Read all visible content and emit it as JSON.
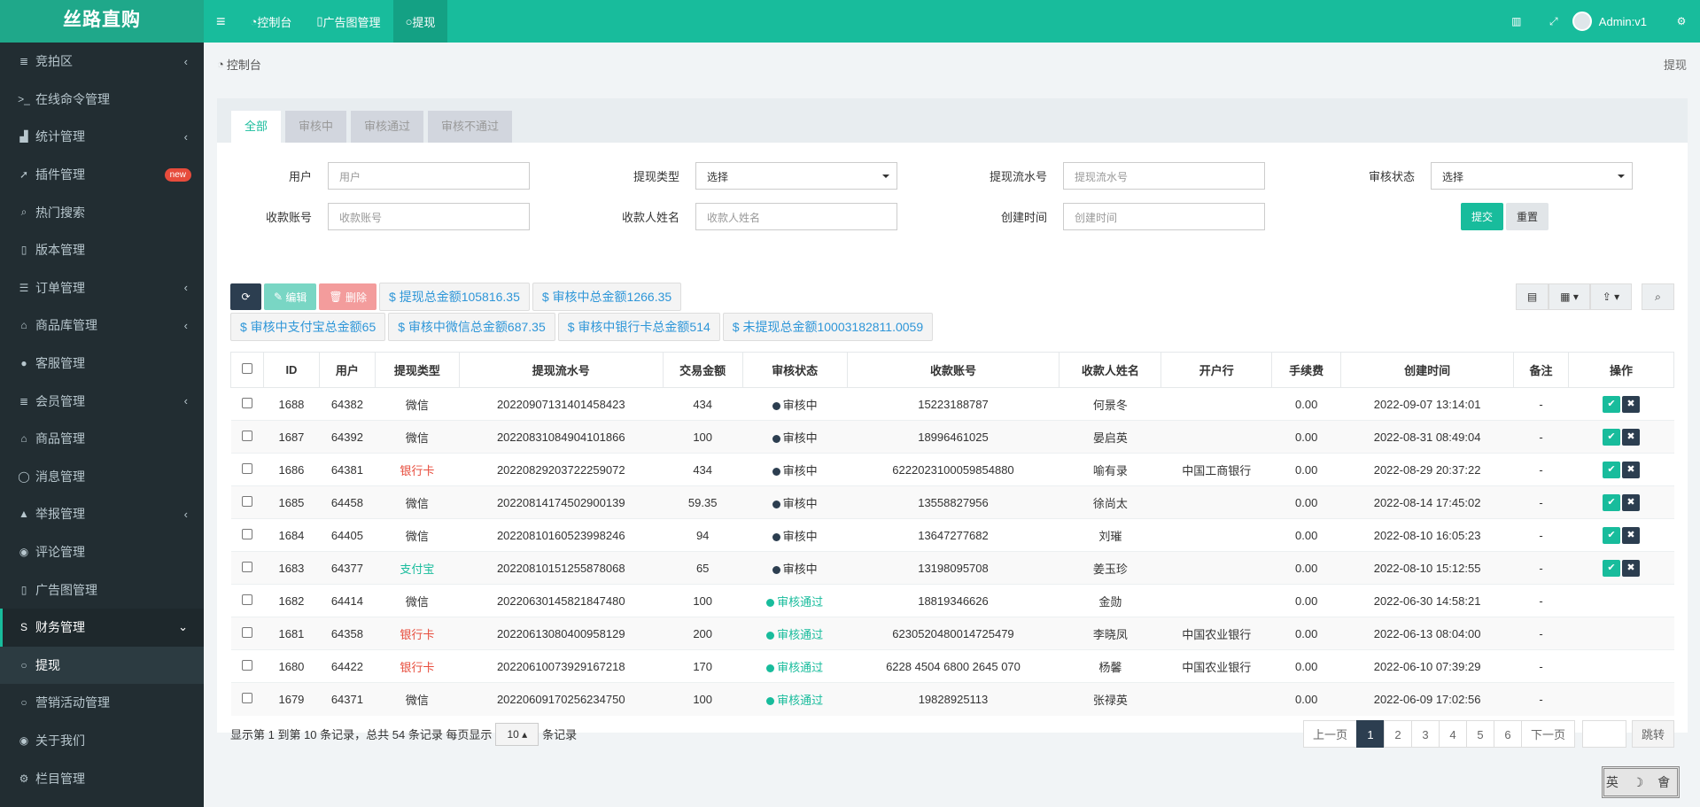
{
  "logo": "丝路直购",
  "sidebar": {
    "items": [
      {
        "label": "竞拍区",
        "icon": "list-icon",
        "arrow": "‹"
      },
      {
        "label": "在线命令管理",
        "icon": "terminal-icon",
        "arrow": ""
      },
      {
        "label": "统计管理",
        "icon": "bar-chart-icon",
        "arrow": "‹"
      },
      {
        "label": "插件管理",
        "icon": "rocket-icon",
        "arrow": "",
        "badge": "new"
      },
      {
        "label": "热门搜索",
        "icon": "search-icon",
        "arrow": ""
      },
      {
        "label": "版本管理",
        "icon": "file-icon",
        "arrow": ""
      },
      {
        "label": "订单管理",
        "icon": "list-alt-icon",
        "arrow": "‹"
      },
      {
        "label": "商品库管理",
        "icon": "bank-icon",
        "arrow": "‹"
      },
      {
        "label": "客服管理",
        "icon": "user-icon",
        "arrow": ""
      },
      {
        "label": "会员管理",
        "icon": "list-icon",
        "arrow": "‹"
      },
      {
        "label": "商品管理",
        "icon": "institution-icon",
        "arrow": ""
      },
      {
        "label": "消息管理",
        "icon": "comments-icon",
        "arrow": ""
      },
      {
        "label": "举报管理",
        "icon": "warning-icon",
        "arrow": "‹"
      },
      {
        "label": "评论管理",
        "icon": "comment-icon",
        "arrow": ""
      },
      {
        "label": "广告图管理",
        "icon": "file-icon",
        "arrow": ""
      },
      {
        "label": "财务管理",
        "icon": "strikethrough-icon",
        "arrow": "⌄",
        "active": true
      },
      {
        "label": "提现",
        "icon": "circle-icon",
        "arrow": "",
        "sub": true,
        "current": true
      },
      {
        "label": "营销活动管理",
        "icon": "circle-icon",
        "arrow": ""
      },
      {
        "label": "关于我们",
        "icon": "user-circle-icon",
        "arrow": ""
      },
      {
        "label": "栏目管理",
        "icon": "cogs-icon",
        "arrow": ""
      }
    ]
  },
  "topbar": {
    "menu_icon": "≡",
    "tabs": [
      {
        "label": "控制台",
        "icon": "dashboard-icon"
      },
      {
        "label": "广告图管理",
        "icon": "file-icon"
      },
      {
        "label": "提现",
        "icon": "circle-icon",
        "active": true
      }
    ],
    "user": "Admin:v1"
  },
  "breadcrumb": {
    "left": "控制台",
    "right": "提现"
  },
  "tabs": [
    "全部",
    "审核中",
    "审核通过",
    "审核不通过"
  ],
  "filters": {
    "user_label": "用户",
    "user_placeholder": "用户",
    "type_label": "提现类型",
    "type_value": "选择",
    "serial_label": "提现流水号",
    "serial_placeholder": "提现流水号",
    "status_label": "审核状态",
    "status_value": "选择",
    "account_label": "收款账号",
    "account_placeholder": "收款账号",
    "name_label": "收款人姓名",
    "name_placeholder": "收款人姓名",
    "time_label": "创建时间",
    "time_placeholder": "创建时间",
    "submit": "提交",
    "reset": "重置"
  },
  "toolbar": {
    "edit": "编辑",
    "delete": "删除",
    "sums": [
      "$ 提现总金额105816.35",
      "$ 审核中总金额1266.35",
      "$ 审核中支付宝总金额65",
      "$ 审核中微信总金额687.35",
      "$ 审核中银行卡总金额514",
      "$ 未提现总金额10003182811.0059"
    ]
  },
  "table": {
    "headers": [
      "ID",
      "用户",
      "提现类型",
      "提现流水号",
      "交易金额",
      "审核状态",
      "收款账号",
      "收款人姓名",
      "开户行",
      "手续费",
      "创建时间",
      "备注",
      "操作"
    ],
    "rows": [
      {
        "id": "1688",
        "user": "64382",
        "type": "微信",
        "serial": "20220907131401458423",
        "amount": "434",
        "status": "审核中",
        "account": "15223188787",
        "name": "何景冬",
        "bank": "",
        "fee": "0.00",
        "time": "2022-09-07 13:14:01",
        "note": "-",
        "ops": true
      },
      {
        "id": "1687",
        "user": "64392",
        "type": "微信",
        "serial": "20220831084904101866",
        "amount": "100",
        "status": "审核中",
        "account": "18996461025",
        "name": "晏启英",
        "bank": "",
        "fee": "0.00",
        "time": "2022-08-31 08:49:04",
        "note": "-",
        "ops": true
      },
      {
        "id": "1686",
        "user": "64381",
        "type": "银行卡",
        "serial": "20220829203722259072",
        "amount": "434",
        "status": "审核中",
        "account": "6222023100059854880",
        "name": "喻有录",
        "bank": "中国工商银行",
        "fee": "0.00",
        "time": "2022-08-29 20:37:22",
        "note": "-",
        "ops": true
      },
      {
        "id": "1685",
        "user": "64458",
        "type": "微信",
        "serial": "20220814174502900139",
        "amount": "59.35",
        "status": "审核中",
        "account": "13558827956",
        "name": "徐尚太",
        "bank": "",
        "fee": "0.00",
        "time": "2022-08-14 17:45:02",
        "note": "-",
        "ops": true
      },
      {
        "id": "1684",
        "user": "64405",
        "type": "微信",
        "serial": "20220810160523998246",
        "amount": "94",
        "status": "审核中",
        "account": "13647277682",
        "name": "刘璀",
        "bank": "",
        "fee": "0.00",
        "time": "2022-08-10 16:05:23",
        "note": "-",
        "ops": true
      },
      {
        "id": "1683",
        "user": "64377",
        "type": "支付宝",
        "serial": "20220810151255878068",
        "amount": "65",
        "status": "审核中",
        "account": "13198095708",
        "name": "姜玉珍",
        "bank": "",
        "fee": "0.00",
        "time": "2022-08-10 15:12:55",
        "note": "-",
        "ops": true
      },
      {
        "id": "1682",
        "user": "64414",
        "type": "微信",
        "serial": "20220630145821847480",
        "amount": "100",
        "status": "审核通过",
        "account": "18819346626",
        "name": "金勋",
        "bank": "",
        "fee": "0.00",
        "time": "2022-06-30 14:58:21",
        "note": "-",
        "ops": false
      },
      {
        "id": "1681",
        "user": "64358",
        "type": "银行卡",
        "serial": "20220613080400958129",
        "amount": "200",
        "status": "审核通过",
        "account": "6230520480014725479",
        "name": "李晓凤",
        "bank": "中国农业银行",
        "fee": "0.00",
        "time": "2022-06-13 08:04:00",
        "note": "-",
        "ops": false
      },
      {
        "id": "1680",
        "user": "64422",
        "type": "银行卡",
        "serial": "20220610073929167218",
        "amount": "170",
        "status": "审核通过",
        "account": "6228 4504 6800 2645 070",
        "name": "杨馨",
        "bank": "中国农业银行",
        "fee": "0.00",
        "time": "2022-06-10 07:39:29",
        "note": "-",
        "ops": false
      },
      {
        "id": "1679",
        "user": "64371",
        "type": "微信",
        "serial": "20220609170256234750",
        "amount": "100",
        "status": "审核通过",
        "account": "19828925113",
        "name": "张禄英",
        "bank": "",
        "fee": "0.00",
        "time": "2022-06-09 17:02:56",
        "note": "-",
        "ops": false
      }
    ]
  },
  "pagination": {
    "info_before": "显示第 1 到第 10 条记录，总共 54 条记录 每页显示",
    "page_size": "10",
    "info_after": "条记录",
    "prev": "上一页",
    "pages": [
      "1",
      "2",
      "3",
      "4",
      "5",
      "6"
    ],
    "next": "下一页",
    "go": "跳转"
  },
  "stamp": "英 ☽ 㑹",
  "colors": {
    "accent": "#18bc9c",
    "dark": "#2c3e50",
    "red": "#e74c3c",
    "sidebar": "#222d32"
  }
}
